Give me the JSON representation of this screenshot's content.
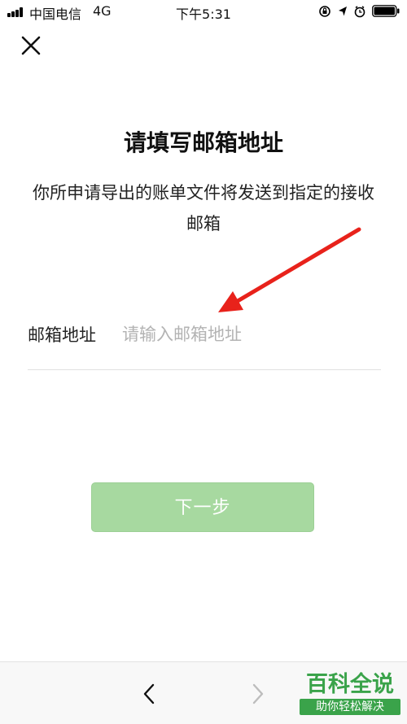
{
  "status_bar": {
    "carrier": "中国电信",
    "network": "4G",
    "time": "下午5:31"
  },
  "header": {
    "close_icon": "close-icon"
  },
  "main": {
    "title": "请填写邮箱地址",
    "description": "你所申请导出的账单文件将发送到指定的接收邮箱",
    "email_label": "邮箱地址",
    "email_placeholder": "请输入邮箱地址",
    "email_value": "",
    "next_button": "下一步"
  },
  "annotation": {
    "arrow_color": "#e8221b"
  },
  "bottom_bar": {
    "back_icon": "chevron-left-icon",
    "forward_icon": "chevron-right-icon"
  },
  "watermark": {
    "title": "百科全说",
    "subtitle": "助你轻松解决"
  },
  "colors": {
    "button_disabled": "#a7d9a0",
    "watermark_green": "#3aa34a",
    "placeholder": "#b3b3b3"
  }
}
